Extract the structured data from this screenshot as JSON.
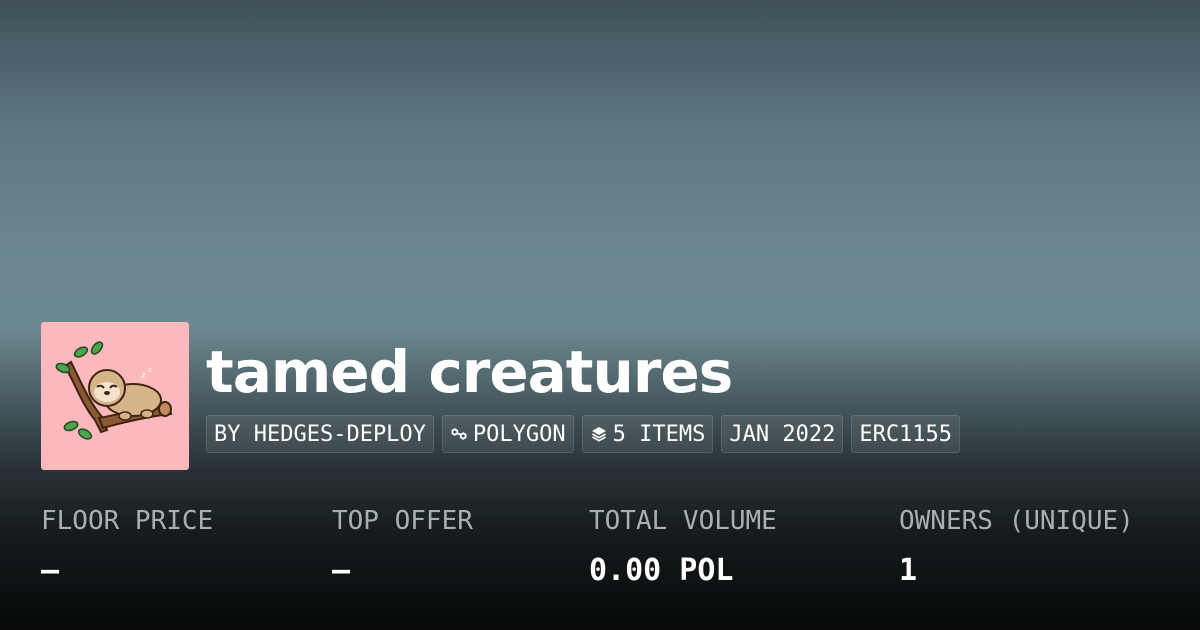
{
  "collection": {
    "title": "tamed creatures",
    "avatar_icon": "sloth-on-branch-illustration",
    "avatar_background": "#fbb8bd"
  },
  "tags": [
    {
      "label": "BY HEDGES-DEPLOY",
      "icon": null
    },
    {
      "label": "POLYGON",
      "icon": "polygon-chain-icon"
    },
    {
      "label": "5 ITEMS",
      "icon": "layers-icon"
    },
    {
      "label": "JAN 2022",
      "icon": null
    },
    {
      "label": "ERC1155",
      "icon": null
    }
  ],
  "stats": [
    {
      "label": "FLOOR PRICE",
      "value": "–"
    },
    {
      "label": "TOP OFFER",
      "value": "–"
    },
    {
      "label": "TOTAL VOLUME",
      "value": "0.00 POL"
    },
    {
      "label": "OWNERS (UNIQUE)",
      "value": "1"
    }
  ]
}
